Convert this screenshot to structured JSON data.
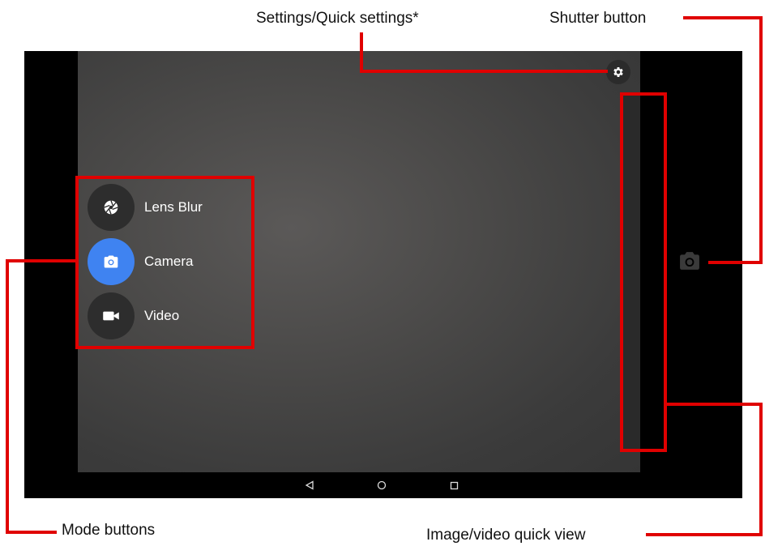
{
  "annotations": {
    "settings": "Settings/Quick settings*",
    "shutter": "Shutter button",
    "modes": "Mode buttons",
    "quickview": "Image/video quick view"
  },
  "modes": [
    {
      "label": "Lens Blur",
      "icon": "aperture-icon",
      "active": false
    },
    {
      "label": "Camera",
      "icon": "camera-icon",
      "active": true
    },
    {
      "label": "Video",
      "icon": "videocam-icon",
      "active": false
    }
  ],
  "navbar": {
    "back": "back-icon",
    "home": "home-icon",
    "recents": "recents-icon"
  },
  "colors": {
    "accent": "#3f83f1",
    "callout": "#e00000"
  }
}
